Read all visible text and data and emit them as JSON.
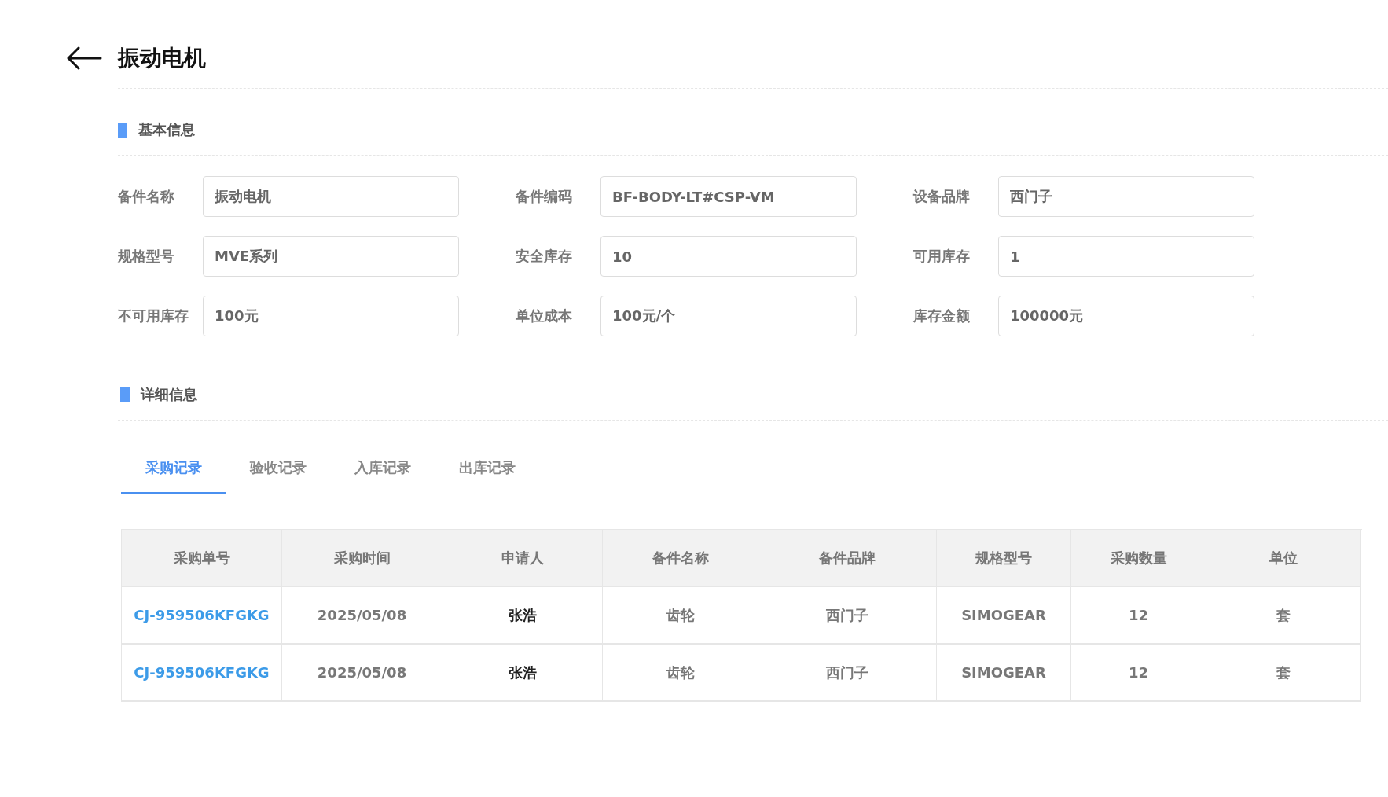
{
  "header": {
    "title": "振动电机"
  },
  "basic_info": {
    "title": "基本信息",
    "fields": [
      {
        "label": "备件名称",
        "value": "振动电机"
      },
      {
        "label": "备件编码",
        "value": "BF-BODY-LT#CSP-VM"
      },
      {
        "label": "设备品牌",
        "value": "西门子"
      },
      {
        "label": "规格型号",
        "value": "MVE系列"
      },
      {
        "label": "安全库存",
        "value": "10"
      },
      {
        "label": "可用库存",
        "value": "1"
      },
      {
        "label": "不可用库存",
        "value": "100元"
      },
      {
        "label": "单位成本",
        "value": "100元/个"
      },
      {
        "label": "库存金额",
        "value": "100000元"
      }
    ]
  },
  "detail_info": {
    "title": "详细信息",
    "tabs": [
      {
        "label": "采购记录",
        "selected": true
      },
      {
        "label": "验收记录",
        "selected": false
      },
      {
        "label": "入库记录",
        "selected": false
      },
      {
        "label": "出库记录",
        "selected": false
      }
    ],
    "table": {
      "columns": [
        {
          "label": "采购单号",
          "kind": "link"
        },
        {
          "label": "采购时间",
          "kind": "text"
        },
        {
          "label": "申请人",
          "kind": "person"
        },
        {
          "label": "备件名称",
          "kind": "text"
        },
        {
          "label": "备件品牌",
          "kind": "text"
        },
        {
          "label": "规格型号",
          "kind": "text"
        },
        {
          "label": "采购数量",
          "kind": "text"
        },
        {
          "label": "单位",
          "kind": "text"
        }
      ],
      "rows": [
        [
          "CJ-959506KFGKG",
          "2025/05/08",
          "张浩",
          "齿轮",
          "西门子",
          "SIMOGEAR",
          "12",
          "套"
        ],
        [
          "CJ-959506KFGKG",
          "2025/05/08",
          "张浩",
          "齿轮",
          "西门子",
          "SIMOGEAR",
          "12",
          "套"
        ]
      ]
    }
  }
}
